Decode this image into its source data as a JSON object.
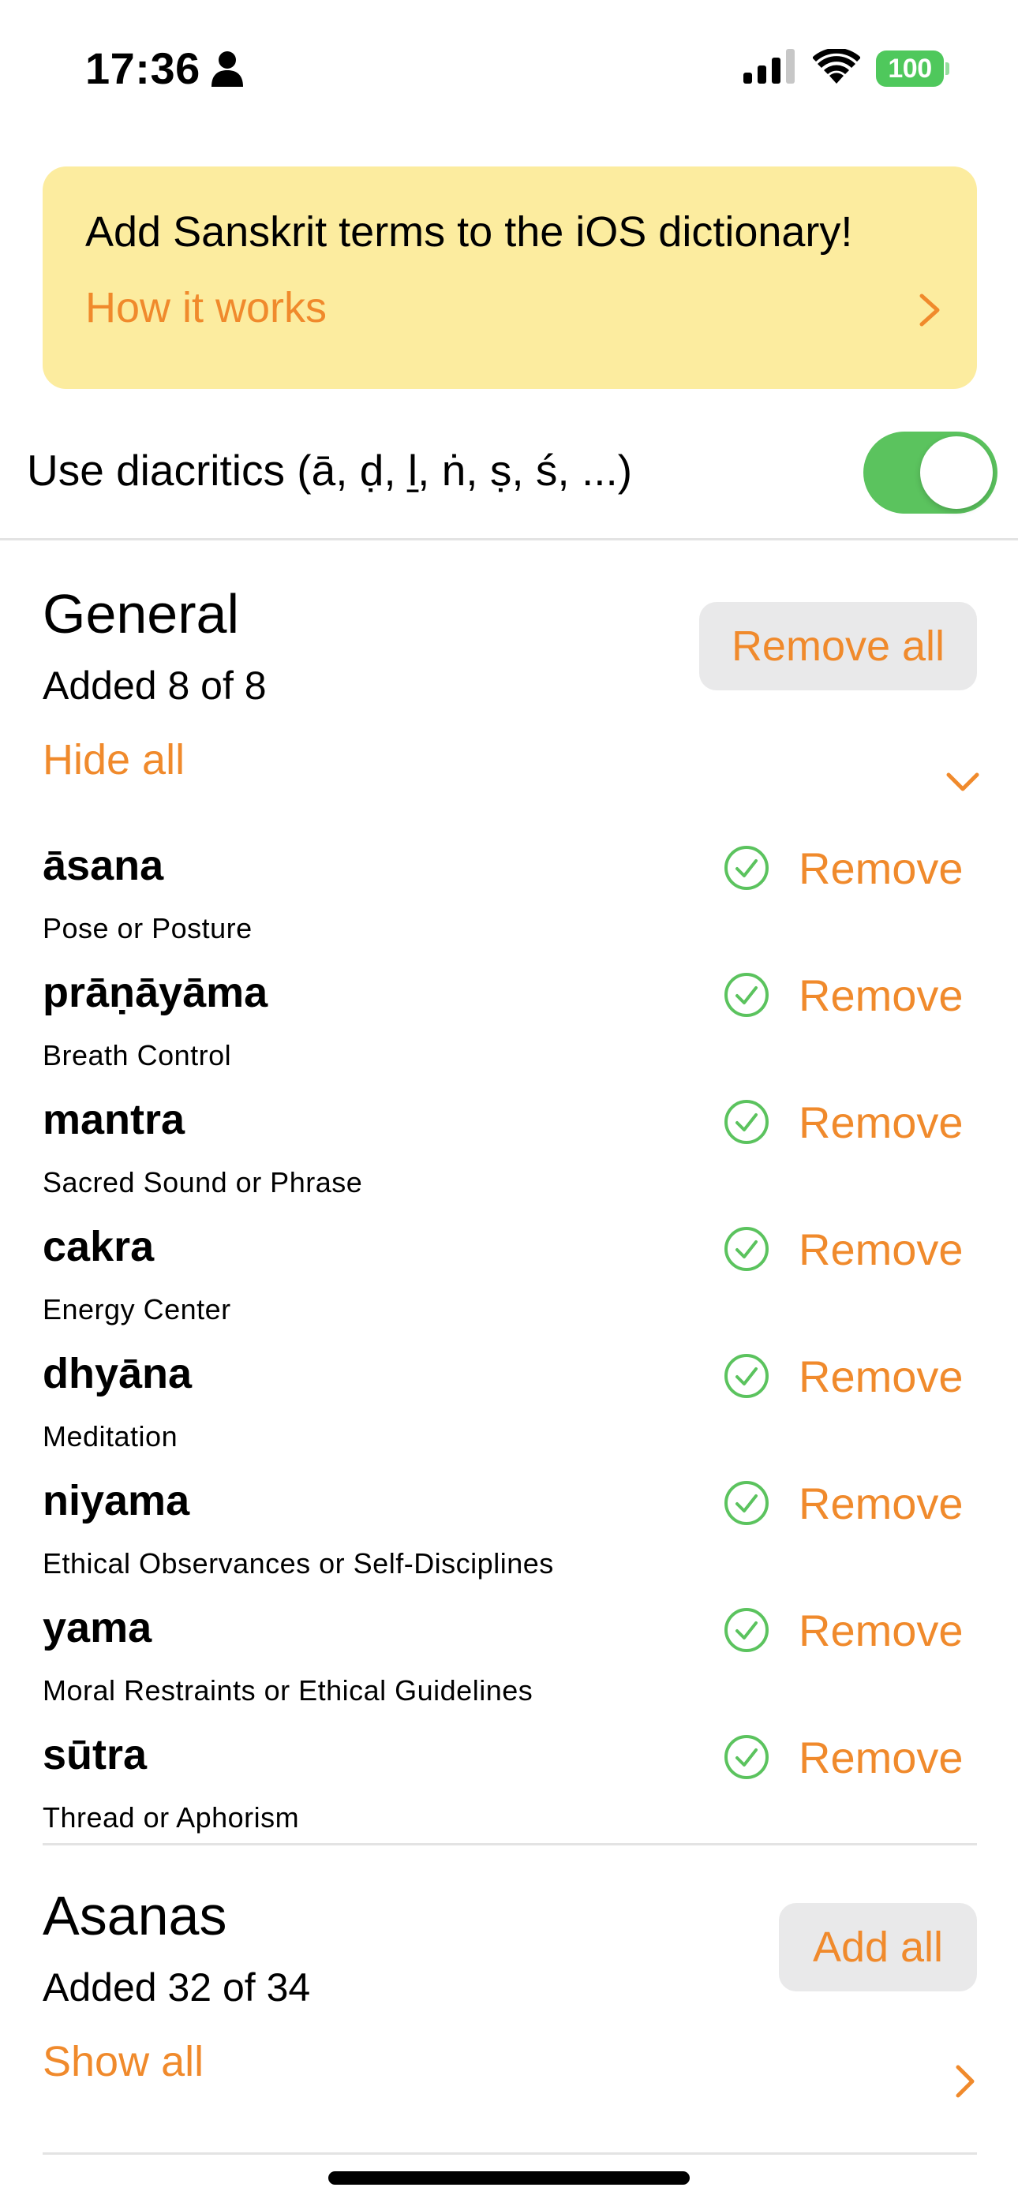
{
  "status_bar": {
    "time": "17:36",
    "battery": "100",
    "icons": [
      "person-icon",
      "cellular-signal-icon",
      "wifi-icon",
      "battery-icon"
    ]
  },
  "banner": {
    "title": "Add Sanskrit terms to the iOS dictionary!",
    "link": "How it works"
  },
  "settings": {
    "diacritics_label": "Use diacritics (ā, ḍ, ḻ, ṅ, ṣ, ś, ...)",
    "diacritics_on": true
  },
  "sections": [
    {
      "title": "General",
      "count": "Added 8 of 8",
      "action": "Remove all",
      "toggle": "Hide all",
      "expanded": true,
      "terms": [
        {
          "name": "āsana",
          "definition": "Pose or Posture",
          "action": "Remove"
        },
        {
          "name": "prāṇāyāma",
          "definition": "Breath Control",
          "action": "Remove"
        },
        {
          "name": "mantra",
          "definition": "Sacred Sound or Phrase",
          "action": "Remove"
        },
        {
          "name": "cakra",
          "definition": "Energy Center",
          "action": "Remove"
        },
        {
          "name": "dhyāna",
          "definition": "Meditation",
          "action": "Remove"
        },
        {
          "name": "niyama",
          "definition": "Ethical Observances or Self-Disciplines",
          "action": "Remove"
        },
        {
          "name": "yama",
          "definition": "Moral Restraints or Ethical Guidelines",
          "action": "Remove"
        },
        {
          "name": "sūtra",
          "definition": "Thread or Aphorism",
          "action": "Remove"
        }
      ]
    },
    {
      "title": "Asanas",
      "count": "Added 32 of 34",
      "action": "Add all",
      "toggle": "Show all",
      "expanded": false
    }
  ],
  "colors": {
    "accent": "#f08a2c",
    "banner_bg": "#fcec9f",
    "toggle_on": "#5bc35e",
    "check": "#5bc35e",
    "pill_bg": "#e9e9ea"
  }
}
